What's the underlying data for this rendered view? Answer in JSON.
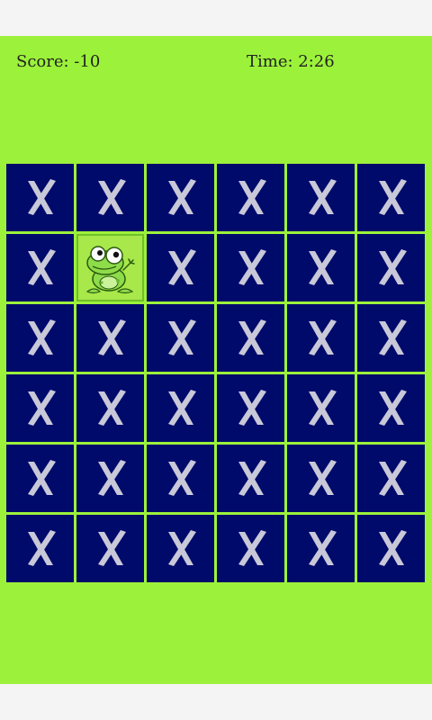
{
  "header": {
    "score_label": "Score: -10",
    "time_label": "Time: 2:26"
  },
  "board": {
    "rows": 6,
    "cols": 6,
    "covered_symbol": "X",
    "revealed": [
      {
        "row": 1,
        "col": 1,
        "icon": "frog-icon"
      }
    ]
  },
  "colors": {
    "background": "#9cf23a",
    "tile_covered": "#000a6b",
    "tile_revealed": "#a8e84a",
    "x_glyph": "#c8c8d8"
  }
}
